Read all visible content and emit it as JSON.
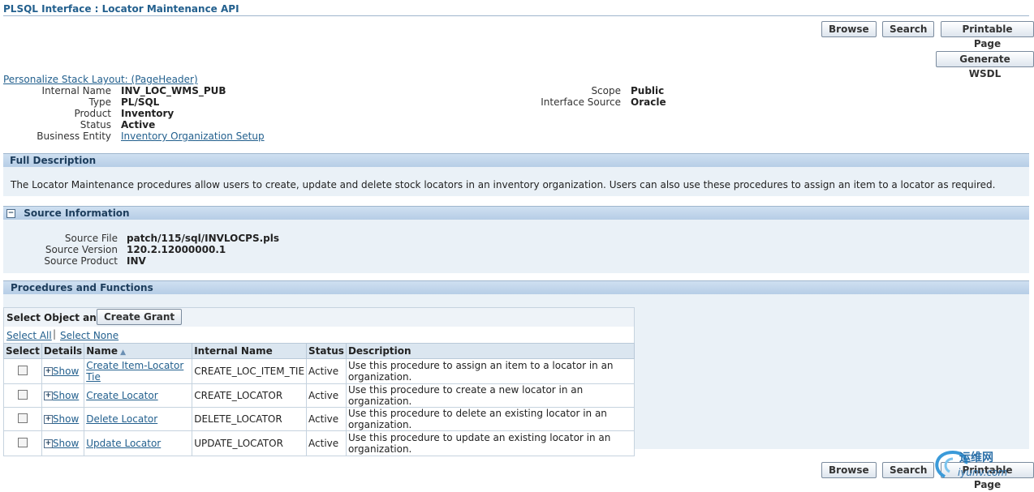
{
  "page": {
    "title": "PLSQL Interface : Locator Maintenance API"
  },
  "top_buttons": {
    "browse": "Browse",
    "search": "Search",
    "printable": "Printable Page",
    "generate_wsdl": "Generate WSDL"
  },
  "personalize_link": "Personalize Stack Layout: (PageHeader)",
  "header_fields_left": [
    {
      "label": "Internal Name",
      "value": "INV_LOC_WMS_PUB"
    },
    {
      "label": "Type",
      "value": "PL/SQL"
    },
    {
      "label": "Product",
      "value": "Inventory"
    },
    {
      "label": "Status",
      "value": "Active"
    },
    {
      "label": "Business Entity",
      "value": "Inventory Organization Setup"
    }
  ],
  "header_fields_right": [
    {
      "label": "Scope",
      "value": "Public"
    },
    {
      "label": "Interface Source",
      "value": "Oracle"
    }
  ],
  "full_description": {
    "heading": "Full Description",
    "text": "The Locator Maintenance procedures allow users to create, update and delete stock locators in an inventory organization. Users can also use these procedures to assign an item to a locator as required."
  },
  "source_info": {
    "heading": "Source Information",
    "fields": [
      {
        "label": "Source File",
        "value": "patch/115/sql/INVLOCPS.pls"
      },
      {
        "label": "Source Version",
        "value": "120.2.12000000.1"
      },
      {
        "label": "Source Product",
        "value": "INV"
      }
    ]
  },
  "procedures": {
    "heading": "Procedures and Functions",
    "select_object_label": "Select Object and",
    "create_grant": "Create Grant",
    "select_all": "Select All",
    "select_none": "Select None",
    "columns": [
      "Select",
      "Details",
      "Name",
      "Internal Name",
      "Status",
      "Description"
    ],
    "rows": [
      {
        "show": "Show",
        "name": "Create Item-Locator Tie",
        "internal": "CREATE_LOC_ITEM_TIE",
        "status": "Active",
        "desc": "Use this procedure to assign an item to a locator in an organization."
      },
      {
        "show": "Show",
        "name": "Create Locator",
        "internal": "CREATE_LOCATOR",
        "status": "Active",
        "desc": "Use this procedure to create a new locator in an organization."
      },
      {
        "show": "Show",
        "name": "Delete Locator",
        "internal": "DELETE_LOCATOR",
        "status": "Active",
        "desc": "Use this procedure to delete an existing locator in an organization."
      },
      {
        "show": "Show",
        "name": "Update Locator",
        "internal": "UPDATE_LOCATOR",
        "status": "Active",
        "desc": "Use this procedure to update an existing locator in an organization."
      }
    ]
  },
  "bottom_buttons": {
    "browse": "Browse",
    "search": "Search",
    "printable": "Printable Page"
  },
  "watermark": {
    "text": "运维网",
    "sub": "iyunv.com"
  }
}
